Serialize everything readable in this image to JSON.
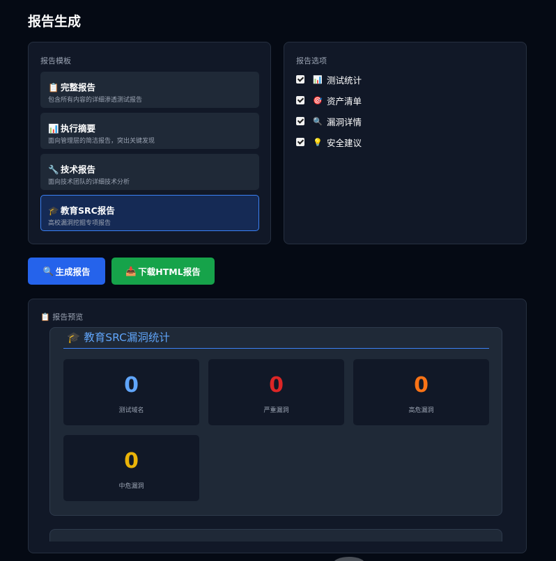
{
  "page": {
    "title": "报告生成"
  },
  "templates": {
    "label": "报告模板",
    "items": [
      {
        "icon": "📋",
        "title": "完整报告",
        "desc": "包含所有内容的详细渗透测试报告",
        "active": false
      },
      {
        "icon": "📊",
        "title": "执行摘要",
        "desc": "面向管理层的简洁报告，突出关键发现",
        "active": false
      },
      {
        "icon": "🔧",
        "title": "技术报告",
        "desc": "面向技术团队的详细技术分析",
        "active": false
      },
      {
        "icon": "🎓",
        "title": "教育SRC报告",
        "desc": "高校漏洞挖掘专项报告",
        "active": true
      }
    ]
  },
  "options": {
    "label": "报告选项",
    "items": [
      {
        "icon": "📊",
        "label": "测试统计",
        "checked": true
      },
      {
        "icon": "🎯",
        "label": "资产清单",
        "checked": true
      },
      {
        "icon": "🔍",
        "label": "漏洞详情",
        "checked": true
      },
      {
        "icon": "💡",
        "label": "安全建议",
        "checked": true
      }
    ]
  },
  "actions": {
    "generate": {
      "icon": "🔍",
      "label": "生成报告"
    },
    "download": {
      "icon": "📥",
      "label": "下载HTML报告"
    }
  },
  "preview": {
    "label": "报告预览",
    "icon": "📋",
    "section_icon": "🎓",
    "section_title": "教育SRC漏洞统计",
    "stats": [
      {
        "value": "0",
        "label": "测试域名",
        "color": "#60a5fa"
      },
      {
        "value": "0",
        "label": "严重漏洞",
        "color": "#dc2626"
      },
      {
        "value": "0",
        "label": "高危漏洞",
        "color": "#f97316"
      },
      {
        "value": "0",
        "label": "中危漏洞",
        "color": "#eab308"
      }
    ]
  }
}
